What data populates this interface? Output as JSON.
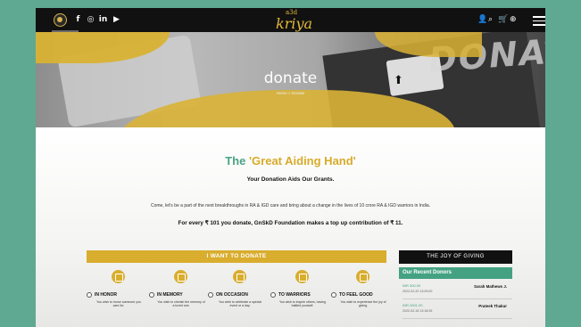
{
  "nav": {
    "brand_small": "a3d",
    "brand_big": "kriya",
    "social": [
      "f",
      "◎",
      "in",
      "▶"
    ],
    "right_icons": [
      "user-icon",
      "search-icon",
      "cart-icon",
      "globe-icon",
      "menu-icon"
    ]
  },
  "hero": {
    "bg_word": "DONATIONS",
    "title": "donate",
    "breadcrumb": "Home » Donate"
  },
  "main": {
    "heading_prefix": "The",
    "heading_highlight": "'Great Aiding Hand'",
    "sub_title": "Your Donation Aids Our Grants.",
    "intro": "Come, let's be a part of the next breakthroughs in RA & IGD care and bring about a change in the lives of 10 crore RA & IGD warriors in India.",
    "top_up": "For every ₹ 101 you donate, GnSkD Foundation makes a top up contribution of ₹ 11."
  },
  "donate": {
    "bar_label": "I WANT TO DONATE",
    "options": [
      {
        "label": "IN HONOR",
        "desc": "You wish to honor someone you care for."
      },
      {
        "label": "IN MEMORY",
        "desc": "You wish to cherish the memory of a loved one."
      },
      {
        "label": "ON OCCASION",
        "desc": "You wish to celebrate a special event or a day."
      },
      {
        "label": "TO WARRIORS",
        "desc": "You wish to inspire others, having battled yourself."
      },
      {
        "label": "TO FEEL GOOD",
        "desc": "You wish to experience the joy of giving."
      }
    ]
  },
  "sidebar": {
    "joy_title": "THE JOY OF GIVING",
    "recent_title": "Our Recent Donors",
    "donors": [
      {
        "amount": "INR 300.00",
        "date": "2022-02-20 13:09:00",
        "name": "Sarah Mathews J."
      },
      {
        "amount": "INR 2001.00",
        "date": "2022-02-18 13:18:26",
        "name": "Prateek Thakur"
      }
    ]
  },
  "colors": {
    "gold": "#d9ad2d",
    "green": "#44a282",
    "dark": "#111111"
  }
}
